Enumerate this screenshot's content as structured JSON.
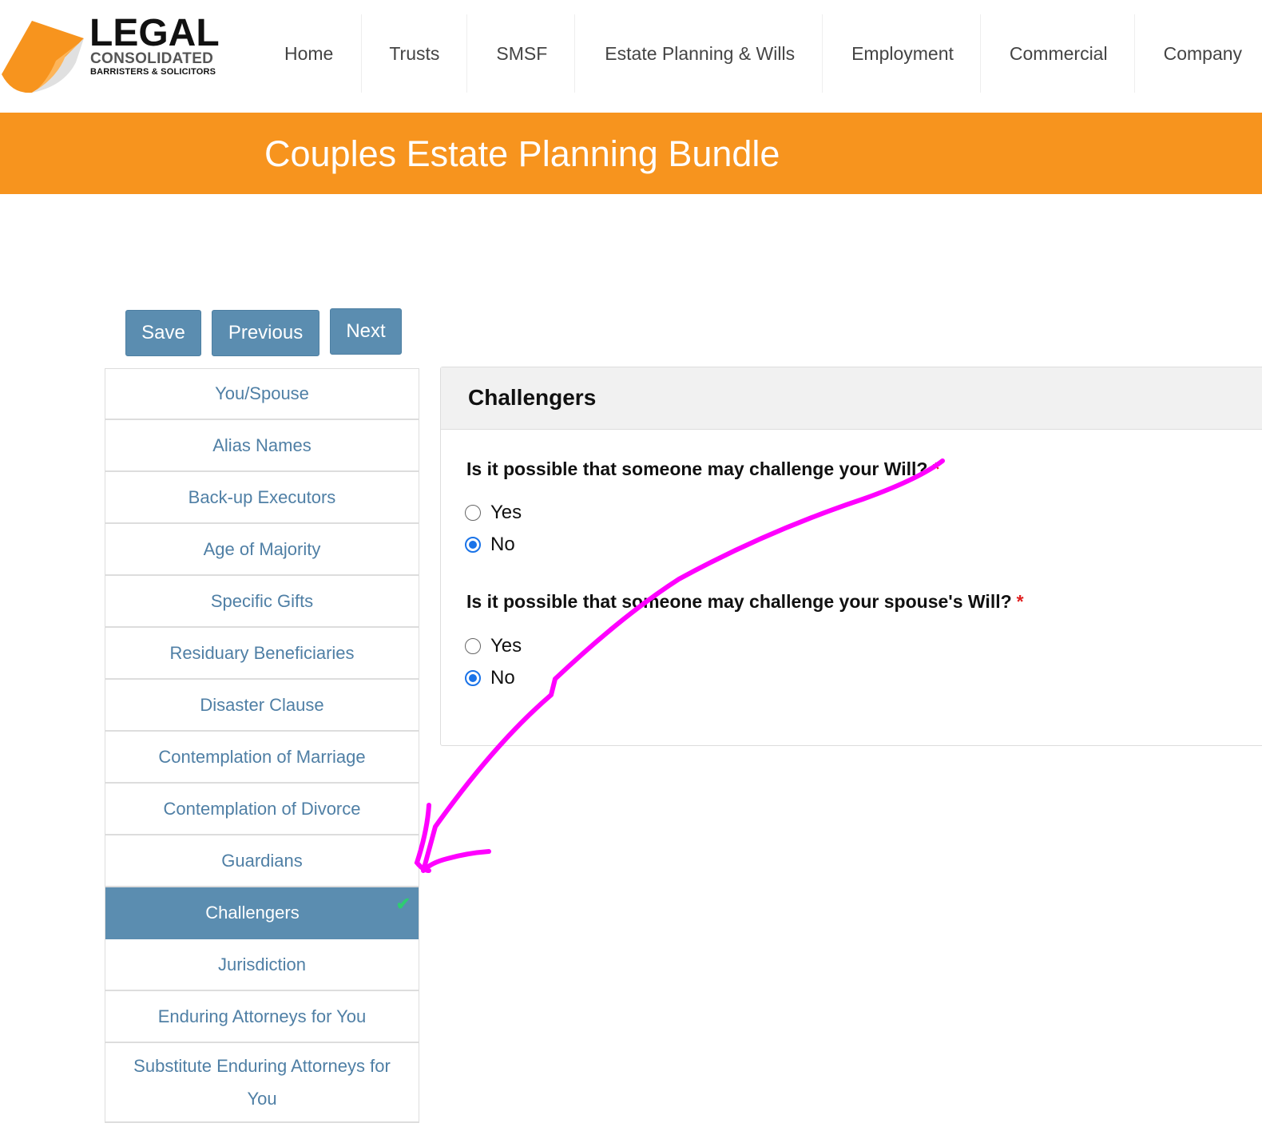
{
  "logo": {
    "line1": "LEGAL",
    "line2": "CONSOLIDATED",
    "line3": "BARRISTERS & SOLICITORS",
    "colors": {
      "orange": "#f7941e",
      "dark": "#111111"
    }
  },
  "nav": {
    "items": [
      {
        "label": "Home"
      },
      {
        "label": "Trusts"
      },
      {
        "label": "SMSF"
      },
      {
        "label": "Estate Planning & Wills"
      },
      {
        "label": "Employment"
      },
      {
        "label": "Commercial"
      },
      {
        "label": "Company"
      }
    ]
  },
  "banner": {
    "title": "Couples Estate Planning Bundle",
    "color": "#f7941e"
  },
  "toolbar": {
    "save_label": "Save",
    "previous_label": "Previous",
    "next_label": "Next"
  },
  "sidebar": {
    "items": [
      {
        "label": "You/Spouse"
      },
      {
        "label": "Alias Names"
      },
      {
        "label": "Back-up Executors"
      },
      {
        "label": "Age of Majority"
      },
      {
        "label": "Specific Gifts"
      },
      {
        "label": "Residuary Beneficiaries"
      },
      {
        "label": "Disaster Clause"
      },
      {
        "label": "Contemplation of Marriage"
      },
      {
        "label": "Contemplation of Divorce"
      },
      {
        "label": "Guardians"
      },
      {
        "label": "Challengers",
        "active": true,
        "completed_icon": "check-icon"
      },
      {
        "label": "Jurisdiction"
      },
      {
        "label": "Enduring Attorneys for You"
      },
      {
        "label": "Substitute Enduring Attorneys for You"
      }
    ]
  },
  "panel": {
    "title": "Challengers",
    "questions": [
      {
        "text": "Is it possible that someone may challenge your Will?",
        "required_mark": "*",
        "options": [
          {
            "label": "Yes",
            "checked": false
          },
          {
            "label": "No",
            "checked": true
          }
        ]
      },
      {
        "text": "Is it possible that someone may challenge your spouse's Will?",
        "required_mark": "*",
        "options": [
          {
            "label": "Yes",
            "checked": false
          },
          {
            "label": "No",
            "checked": true
          }
        ]
      }
    ]
  },
  "annotation": {
    "type": "hand-drawn-arrow",
    "color": "#ff00ff"
  }
}
